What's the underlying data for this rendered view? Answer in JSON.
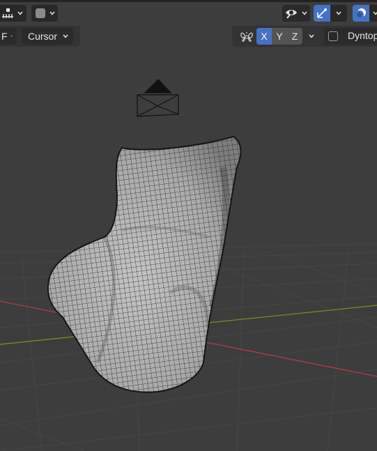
{
  "header": {
    "mode_icon": "snapping-grid-icon",
    "shading_icon": "sphere-icon",
    "overlay_icon": "eye-visibility-icon",
    "gizmo_icon": "gizmo-toggle-icon",
    "xray_icon": "xray-overlay-icon"
  },
  "tool_settings": {
    "orientation_fragment": "F",
    "pivot_label": "Cursor",
    "symmetry_icon": "butterfly-mirror-icon",
    "axes": [
      {
        "label": "X",
        "active": true
      },
      {
        "label": "Y",
        "active": false
      },
      {
        "label": "Z",
        "active": false
      }
    ],
    "dyntopo_label": "Dyntopo",
    "dyntopo_checked": false
  },
  "colors": {
    "viewport_bg": "#3d3d3d",
    "header_bg": "#333333",
    "active_blue": "#4672c4",
    "x_axis_red": "#a83d4a",
    "y_axis_green": "#6b8a2a"
  },
  "viewport": {
    "object_icon": "camera-object-icon",
    "mesh": "sculpted-mesh-wireframe"
  }
}
